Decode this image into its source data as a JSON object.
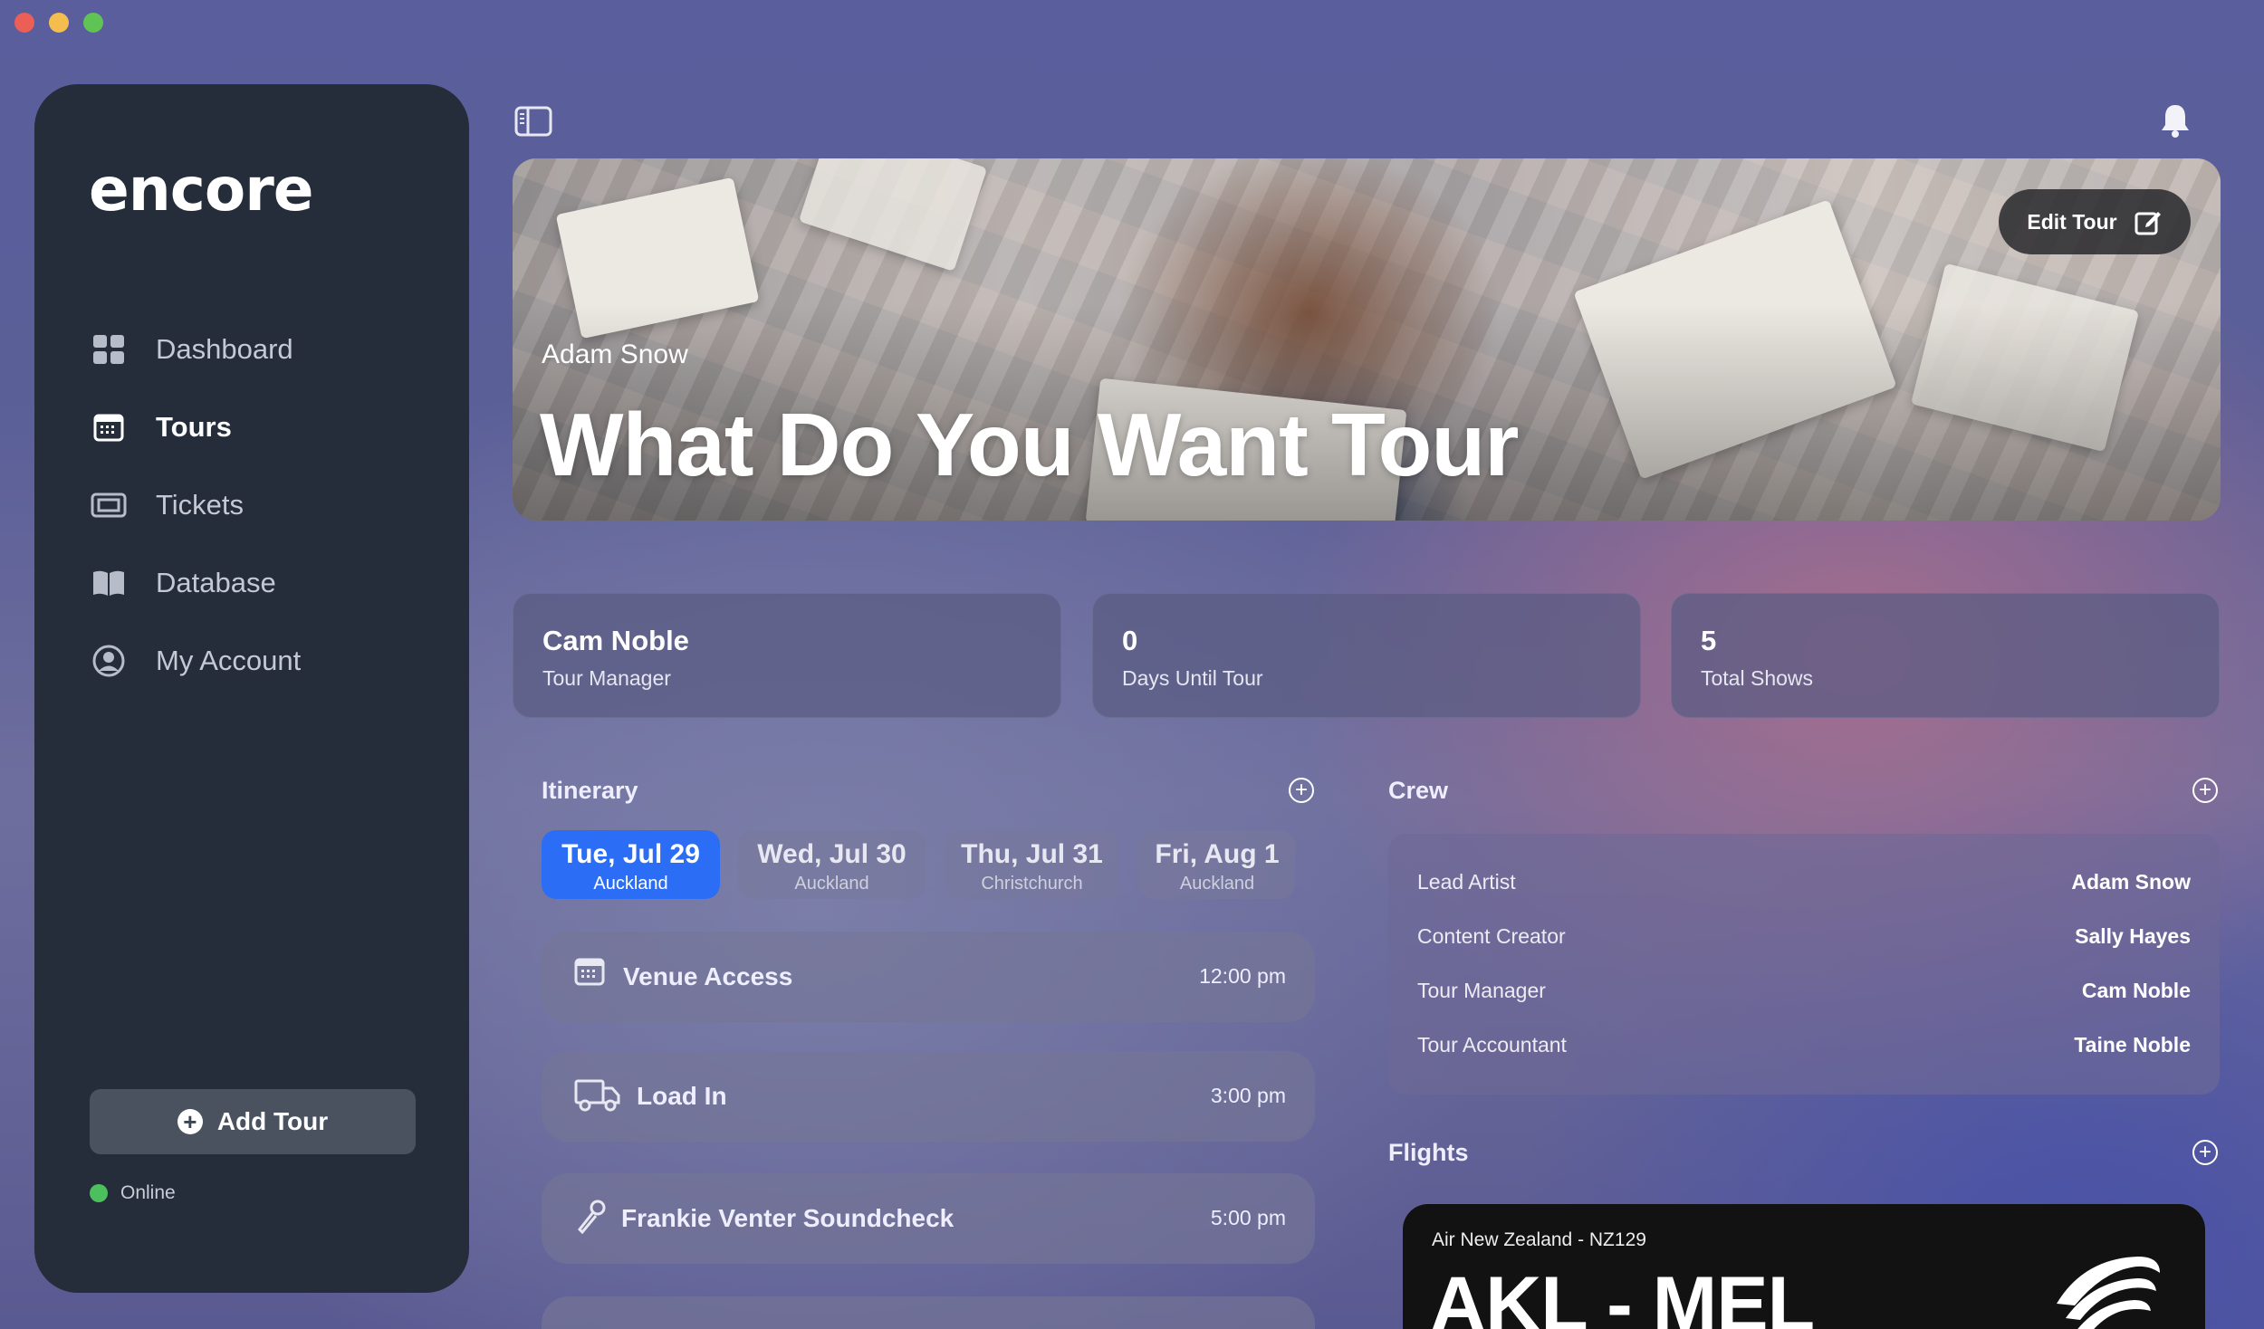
{
  "app": {
    "logo": "encore"
  },
  "sidebar": {
    "items": [
      {
        "label": "Dashboard",
        "icon": "grid-icon",
        "active": false
      },
      {
        "label": "Tours",
        "icon": "calendar-icon",
        "active": true
      },
      {
        "label": "Tickets",
        "icon": "ticket-icon",
        "active": false
      },
      {
        "label": "Database",
        "icon": "book-icon",
        "active": false
      },
      {
        "label": "My Account",
        "icon": "user-circle-icon",
        "active": false
      }
    ],
    "add_tour_label": "Add Tour",
    "status_label": "Online",
    "status_color": "#4bc05c"
  },
  "hero": {
    "artist": "Adam Snow",
    "title": "What Do You Want Tour",
    "edit_label": "Edit Tour"
  },
  "stats": [
    {
      "value": "Cam Noble",
      "label": "Tour Manager"
    },
    {
      "value": "0",
      "label": "Days Until Tour"
    },
    {
      "value": "5",
      "label": "Total Shows"
    }
  ],
  "itinerary": {
    "title": "Itinerary",
    "days": [
      {
        "date": "Tue, Jul 29",
        "city": "Auckland",
        "active": true
      },
      {
        "date": "Wed, Jul 30",
        "city": "Auckland",
        "active": false
      },
      {
        "date": "Thu, Jul 31",
        "city": "Christchurch",
        "active": false
      },
      {
        "date": "Fri, Aug 1",
        "city": "Auckland",
        "active": false
      }
    ],
    "events": [
      {
        "name": "Venue Access",
        "time": "12:00 pm",
        "icon": "calendar-icon"
      },
      {
        "name": "Load In",
        "time": "3:00 pm",
        "icon": "truck-icon"
      },
      {
        "name": "Frankie Venter Soundcheck",
        "time": "5:00 pm",
        "icon": "microphone-icon"
      }
    ],
    "accent_color": "#2b6ef5"
  },
  "crew": {
    "title": "Crew",
    "members": [
      {
        "role": "Lead Artist",
        "name": "Adam Snow"
      },
      {
        "role": "Content Creator",
        "name": "Sally Hayes"
      },
      {
        "role": "Tour Manager",
        "name": "Cam Noble"
      },
      {
        "role": "Tour Accountant",
        "name": "Taine Noble"
      }
    ]
  },
  "flights": {
    "title": "Flights",
    "items": [
      {
        "airline": "Air New Zealand - NZ129",
        "route": "AKL - MEL",
        "icon": "air-new-zealand-koru-icon"
      }
    ]
  }
}
